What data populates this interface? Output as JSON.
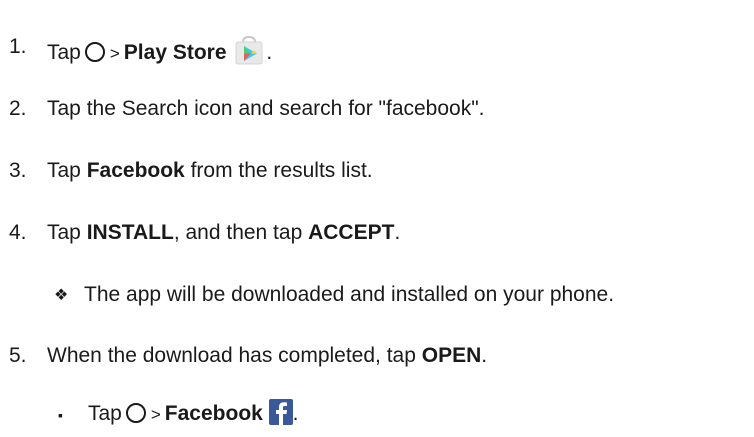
{
  "steps": [
    {
      "num": "1.",
      "tap": "Tap",
      "gt": ">",
      "bold": "Play Store",
      "end": "."
    },
    {
      "num": "2.",
      "text": "Tap the Search icon and search for \"facebook\"."
    },
    {
      "num": "3.",
      "pre": "Tap ",
      "bold": "Facebook",
      "post": " from the results list."
    },
    {
      "num": "4.",
      "pre": "Tap ",
      "bold1": "INSTALL",
      "mid": ", and then tap ",
      "bold2": "ACCEPT",
      "post": "."
    },
    {
      "bullet": "❖",
      "text": "The app will be downloaded and installed on your phone."
    },
    {
      "num": "5.",
      "pre": "When the download has completed, tap ",
      "bold": "OPEN",
      "post": "."
    },
    {
      "bullet": "▪",
      "tap": "Tap",
      "gt": ">",
      "bold": "Facebook",
      "end": "."
    }
  ],
  "icons": {
    "circle": "home-circle-icon",
    "play_store": "play-store-icon",
    "facebook": "facebook-icon"
  },
  "colors": {
    "text": "#1a1a1a",
    "play_bag": "#e6e6e6",
    "play_green": "#3bccff",
    "facebook_blue": "#3b5998"
  }
}
